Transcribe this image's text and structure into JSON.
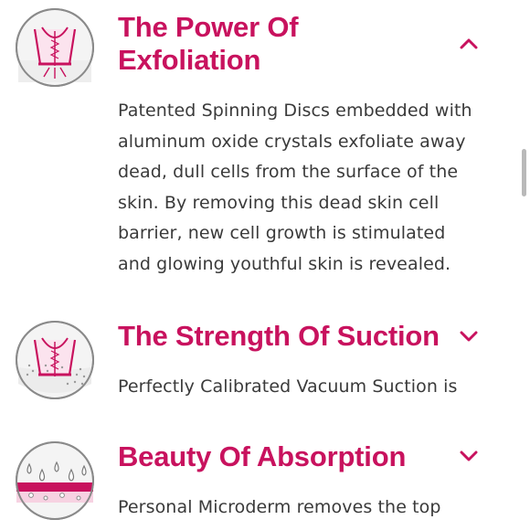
{
  "colors": {
    "accent": "#c8125e",
    "text": "#3a3a3a",
    "icon_ring": "#8a8a8a",
    "icon_fill": "#f3f3f3"
  },
  "sections": [
    {
      "title_line1": "The Power Of",
      "title_line2": "Exfoliation",
      "expanded": true,
      "chevron_icon": "chevron-up-icon",
      "icon": "exfoliation-icon",
      "body_lines": [
        "Patented Spinning Discs embedded with",
        "aluminum oxide crystals exfoliate away",
        "dead, dull cells from the surface of the",
        "skin. By removing this dead skin cell",
        "barrier, new cell growth is stimulated",
        "and glowing youthful skin is revealed."
      ]
    },
    {
      "title_line1": "The Strength Of Suction",
      "expanded": false,
      "chevron_icon": "chevron-down-icon",
      "icon": "suction-icon",
      "body_lines": [
        "Perfectly Calibrated Vacuum Suction is"
      ]
    },
    {
      "title_line1": "Beauty Of Absorption",
      "expanded": false,
      "chevron_icon": "chevron-down-icon",
      "icon": "absorption-icon",
      "body_lines": [
        "Personal Microderm removes the top"
      ]
    }
  ]
}
